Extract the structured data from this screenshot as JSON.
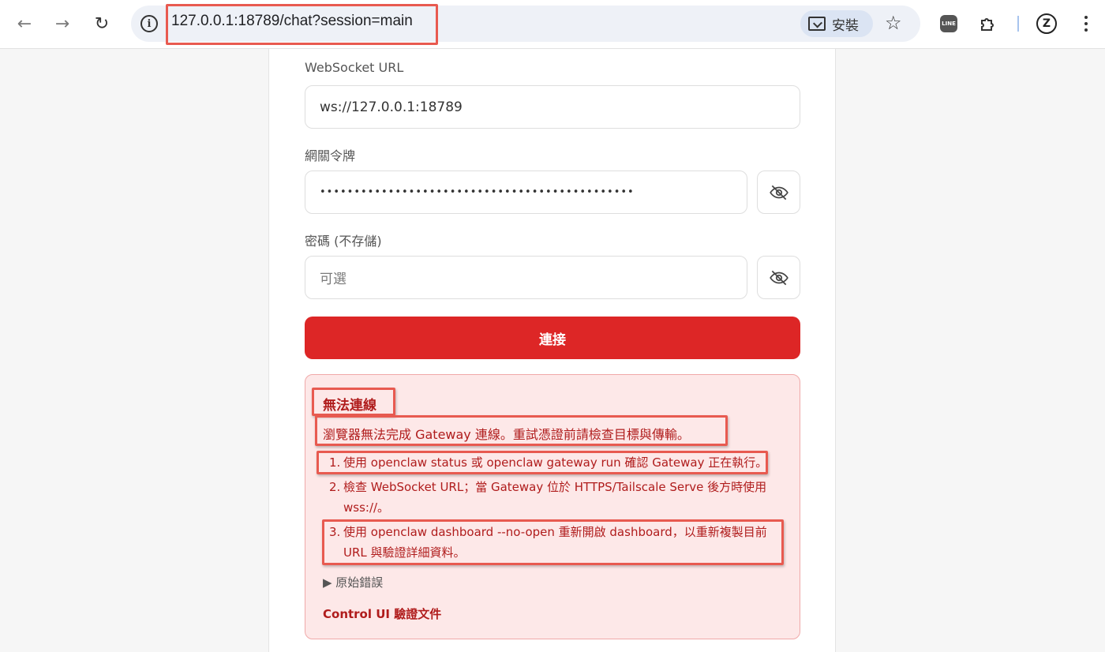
{
  "browser": {
    "url": "127.0.0.1:18789/chat?session=main",
    "install_label": "安裝",
    "line_ext_label": "LINE",
    "z_ext_label": "Z"
  },
  "form": {
    "ws_label": "WebSocket URL",
    "ws_value": "ws://127.0.0.1:18789",
    "token_label": "網關令牌",
    "token_value": "••••••••••••••••••••••••••••••••••••••••••••••",
    "password_label": "密碼 (不存儲)",
    "password_placeholder": "可選",
    "connect_label": "連接"
  },
  "error": {
    "title": "無法連線",
    "description": "瀏覽器無法完成 Gateway 連線。重試憑證前請檢查目標與傳輸。",
    "steps": [
      {
        "num": "1.",
        "text": "使用 openclaw status 或 openclaw gateway run 確認 Gateway 正在執行。"
      },
      {
        "num": "2.",
        "text": "檢查 WebSocket URL；當 Gateway 位於 HTTPS/Tailscale Serve 後方時使用 wss://。"
      },
      {
        "num": "3.",
        "text": "使用 openclaw dashboard --no-open 重新開啟 dashboard，以重新複製目前 URL 與驗證詳細資料。"
      }
    ],
    "raw_toggle": "▶ 原始錯誤",
    "doc_link": "Control UI 驗證文件"
  },
  "colors": {
    "accent": "#dd2626",
    "error_bg": "#fde8e8",
    "error_text": "#b01c1c",
    "highlight": "#e85a50"
  }
}
